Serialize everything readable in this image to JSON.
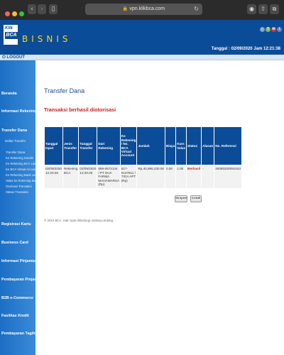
{
  "browser": {
    "url": "vpn.klikbca.com",
    "colors": {
      "close": "#ff5f57",
      "minimize": "#febc2e",
      "maximize": "#28c840"
    },
    "icons": {
      "back": "chevron-left-icon",
      "forward": "chevron-right-icon",
      "sidebar": "sidebar-icon",
      "lock": "lock-icon",
      "reload": "reload-icon",
      "shield": "shield-icon",
      "share": "share-icon",
      "tabs": "tabs-icon"
    }
  },
  "header": {
    "logo": {
      "line1": "Klik",
      "line2": "BCA"
    },
    "brand": "BISNIS",
    "date_line": "Tanggal : 02/09/2020 Jam 12:21:38",
    "brand_color": "#0b4c98"
  },
  "logout": {
    "label": "LOGOUT"
  },
  "sidebar": {
    "items": [
      {
        "label": "Beranda"
      },
      {
        "label": "Informasi Rekening"
      },
      {
        "label": "Transfer Dana"
      },
      {
        "label": "Registrasi Kartu"
      },
      {
        "label": "Business Card"
      },
      {
        "label": "Informasi Pinjaman"
      },
      {
        "label": "Pembayaran Pinjaman"
      },
      {
        "label": "B2B e-Commerce"
      },
      {
        "label": "Fasilitas Kredit"
      },
      {
        "label": "Pembayaran Tagihan"
      }
    ],
    "transfer_sub": [
      "Daftar Transfer"
    ],
    "transfer_sub2": [
      "Transfer Dana",
      "Ke Rekening Sendiri",
      "Ke Rekening BCA Lain",
      "Ke BCA Virtual Account",
      "Ke Rekening Bank Lain",
      "Valas ke Rekening Bank",
      "Otorisasi Transaksi",
      "Status Transaksi"
    ]
  },
  "main": {
    "title": "Transfer Dana",
    "subtitle": "Transaksi berhasil diotorisasi",
    "table": {
      "headers": [
        "Tanggal Input",
        "Jenis Transfer",
        "Tanggal Transfer",
        "Dari Rekening",
        "Ke Rekening / No. BCA Virtual Account",
        "Jumlah",
        "Biaya",
        "Kurs Valas",
        "Status",
        "Alasan",
        "No. Referensi"
      ],
      "rows": [
        [
          "02/09/2020 12:20:25",
          "Rekening BCA",
          "02/09/2020 12:20:25",
          "869-0672144 / PT DUA FARMA MAHAMARSA (Rp)",
          "517-0137811 / TIGA APT (Rp)",
          "Rp.40,986,330.00",
          "0.00",
          "1.00",
          "Berhasil",
          "-",
          "20090200091043"
        ]
      ]
    },
    "buttons": {
      "save": "Simpan",
      "print": "Cetak"
    },
    "copyright": "© 2010 BCA. Hak cipta dilindungi undang-undang."
  }
}
